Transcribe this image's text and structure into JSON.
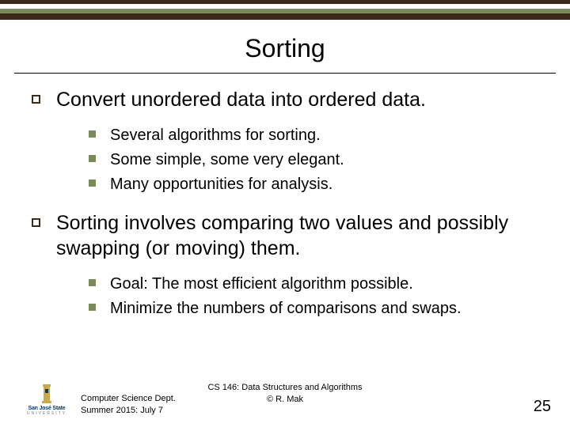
{
  "title": "Sorting",
  "bullets": [
    {
      "text": "Convert unordered data into ordered data.",
      "sub": [
        "Several algorithms for sorting.",
        "Some simple, some very elegant.",
        "Many opportunities for analysis."
      ]
    },
    {
      "text": "Sorting involves comparing two values and possibly swapping (or moving) them.",
      "sub": [
        "Goal: The most efficient algorithm possible.",
        "Minimize the numbers of comparisons and swaps."
      ]
    }
  ],
  "footer": {
    "dept": "Computer Science Dept.",
    "date": "Summer 2015: July 7",
    "course": "CS 146: Data Structures and Algorithms",
    "author": "© R. Mak",
    "page": "25",
    "logo_name": "San José State",
    "logo_sub": "UNIVERSITY"
  },
  "colors": {
    "dark": "#3b2a1a",
    "green": "#7a8a5a",
    "logo_blue": "#0a3a6a",
    "logo_gold": "#c9a94a"
  }
}
